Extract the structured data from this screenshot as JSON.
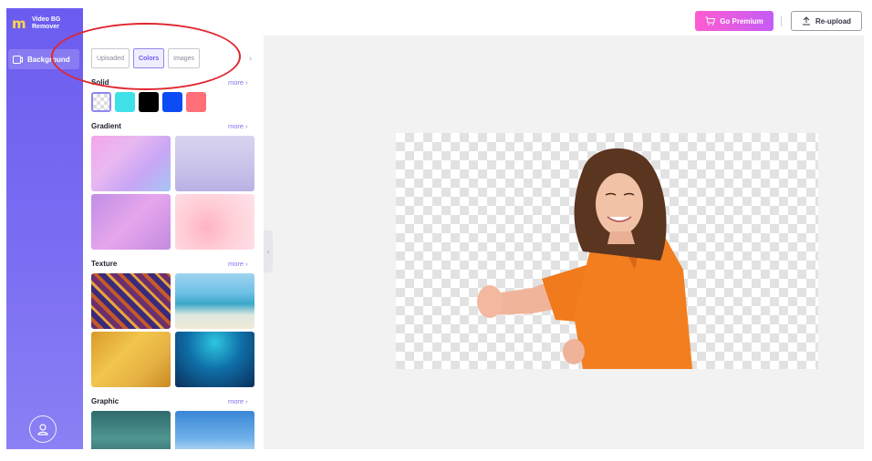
{
  "app": {
    "logo_line1": "Video BG",
    "logo_line2": "Remover"
  },
  "sidebar": {
    "items": [
      {
        "label": "Background",
        "icon": "background-icon"
      }
    ],
    "avatar_icon": "user-icon"
  },
  "topbar": {
    "premium_label": "Go Premium",
    "reupload_label": "Re-upload"
  },
  "panel": {
    "tabs": [
      {
        "label": "Uploaded"
      },
      {
        "label": "Colors",
        "active": true
      },
      {
        "label": "Images"
      }
    ],
    "sections": {
      "solid": {
        "title": "Solid",
        "more": "more ›"
      },
      "gradient": {
        "title": "Gradient",
        "more": "more ›"
      },
      "texture": {
        "title": "Texture",
        "more": "more ›"
      },
      "graphic": {
        "title": "Graphic",
        "more": "more ›"
      }
    },
    "solid_colors": [
      "#3fe0e8",
      "#000000",
      "#0d4cf5",
      "#ff6f78"
    ]
  },
  "colors": {
    "accent": "#6b5cf0",
    "premium_start": "#ff5bd1",
    "premium_end": "#c45cf6",
    "annotation": "#e0262e"
  }
}
